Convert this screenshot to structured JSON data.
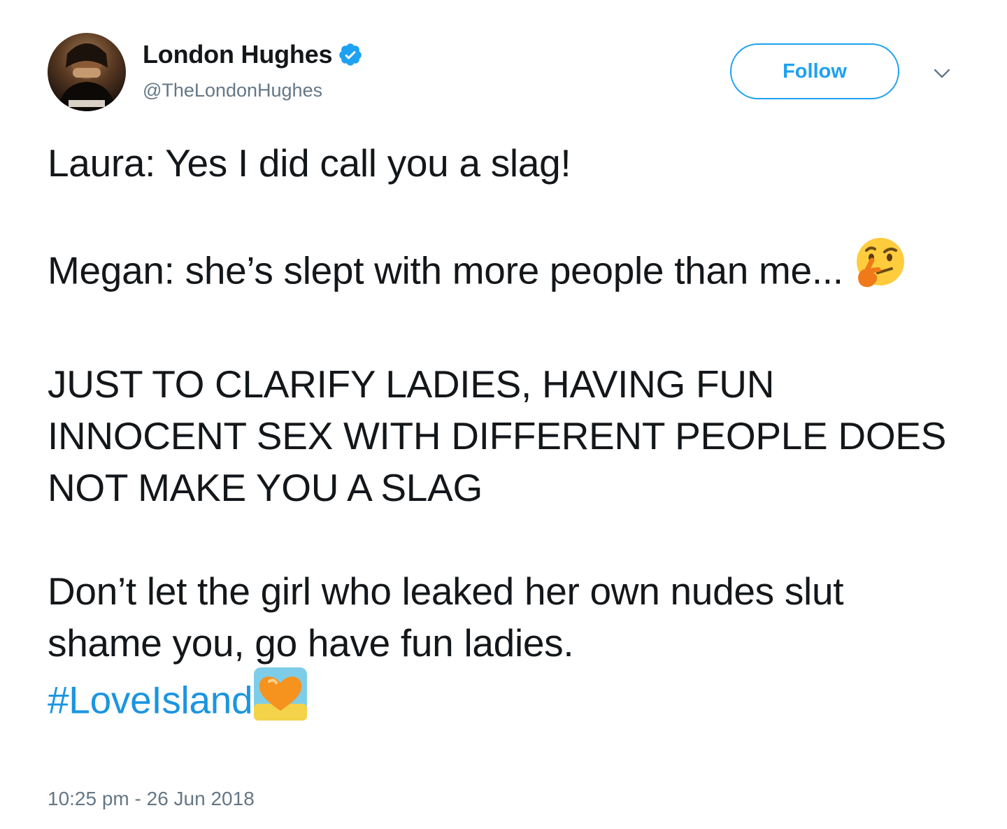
{
  "user": {
    "display_name": "London Hughes",
    "handle": "@TheLondonHughes",
    "verified": true
  },
  "actions": {
    "follow_label": "Follow"
  },
  "tweet": {
    "line1": "Laura: Yes I did call you a slag!",
    "line2": "Megan: she’s slept with more people than me...",
    "line3": "JUST TO CLARIFY LADIES, HAVING FUN INNOCENT SEX WITH DIFFERENT PEOPLE DOES NOT MAKE YOU A SLAG",
    "line4": "Don’t let the girl who leaked her own nudes slut shame you, go have fun ladies.",
    "hashtag": "#LoveIsland"
  },
  "timestamp": "10:25 pm - 26 Jun 2018",
  "icons": {
    "verified": "verified-badge-icon",
    "chevron": "chevron-down-icon",
    "thinking": "thinking-face-emoji",
    "island_heart": "love-island-heart-emoji"
  },
  "colors": {
    "brand_blue": "#1da1f2",
    "hashtag_blue": "#1b95e0",
    "muted_gray": "#657786",
    "text": "#14171a"
  }
}
